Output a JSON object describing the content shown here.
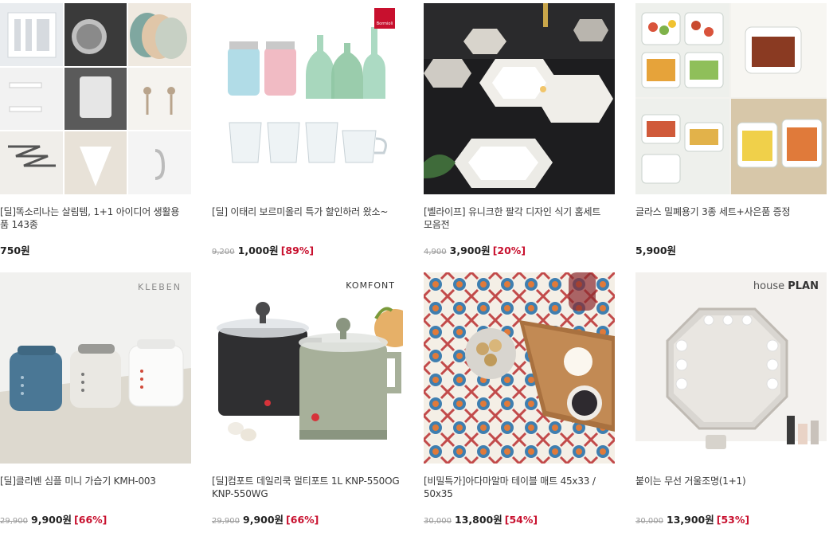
{
  "colors": {
    "discount": "#c8102e",
    "price": "#222222",
    "original_price": "#9a9a9a",
    "title": "#3a3a3a"
  },
  "products": [
    {
      "title": "[딜]똑소리나는 살림템, 1+1 아이디어 생활용품 143종",
      "original_price": "",
      "price": "750원",
      "discount": ""
    },
    {
      "title": "[딜] 이태리 보르미올리 특가 할인하러 왔소~",
      "brand": "Bormioli",
      "original_price": "9,200",
      "price": "1,000원",
      "discount": "[89%]"
    },
    {
      "title": "[벨라이프] 유니크한 팔각 디자인 식기 홈세트 모음전",
      "original_price": "4,900",
      "price": "3,900원",
      "discount": "[20%]"
    },
    {
      "title": "글라스 밀폐용기 3종 세트+사은품 증정",
      "original_price": "",
      "price": "5,900원",
      "discount": ""
    },
    {
      "title": "[딜]클리벤 심플 미니 가습기 KMH-003",
      "brand": "KLEBEN",
      "original_price": "29,900",
      "price": "9,900원",
      "discount": "[66%]"
    },
    {
      "title": "[딜]컴포트 데일리쿡 멀티포트 1L KNP-550OG KNP-550WG",
      "brand": "KOMFONT",
      "original_price": "29,900",
      "price": "9,900원",
      "discount": "[66%]"
    },
    {
      "title": "[비밀특가]아다마알마 테이블 매트 45x33 / 50x35",
      "original_price": "30,000",
      "price": "13,800원",
      "discount": "[54%]"
    },
    {
      "title": "붙이는 무선 거울조명(1+1)",
      "brand_light": "house",
      "brand_bold": "PLAN",
      "original_price": "30,000",
      "price": "13,900원",
      "discount": "[53%]"
    }
  ]
}
